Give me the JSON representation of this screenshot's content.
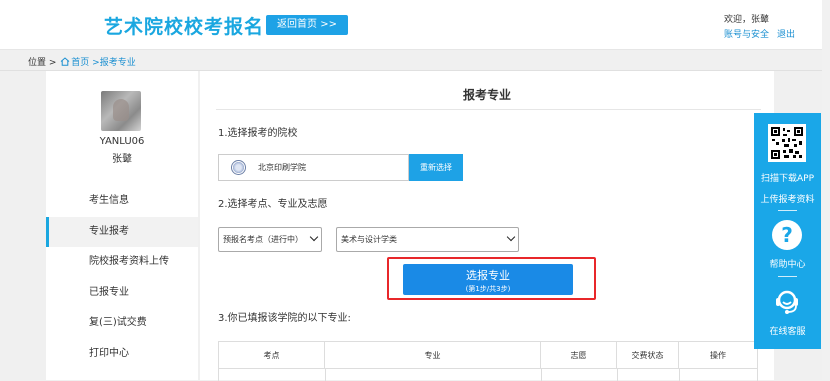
{
  "header": {
    "site_title": "艺术院校校考报名",
    "home_button": "返回首页 >>",
    "welcome": "欢迎，张鼙",
    "account_security": "账号与安全",
    "logout": "退出"
  },
  "breadcrumb": {
    "position": "位置 >",
    "home": "首页",
    "current": ">报考专业"
  },
  "sidebar": {
    "username": "YANLU06",
    "realname": "张鼙",
    "items": [
      {
        "label": "考生信息"
      },
      {
        "label": "专业报考"
      },
      {
        "label": "院校报考资料上传"
      },
      {
        "label": "已报专业"
      },
      {
        "label": "复(三)试交费"
      },
      {
        "label": "打印中心"
      }
    ]
  },
  "main": {
    "title": "报考专业",
    "step1": "1.选择报考的院校",
    "school_name": "北京印刷学院",
    "reselect": "重新选择",
    "step2": "2.选择考点、专业及志愿",
    "exam_site_select": "预报名考点（进行中）",
    "major_select": "美术与设计学类",
    "submit_line1": "选报专业",
    "submit_line2": "(第1步/共3步)",
    "step3": "3.你已填报该学院的以下专业:",
    "table_headers": [
      "考点",
      "专业",
      "志愿",
      "交费状态",
      "操作"
    ]
  },
  "floatbar": {
    "download_app": "扫描下载APP",
    "upload": "上传报考资料",
    "help": "帮助中心",
    "service": "在线客服",
    "help_icon": "?"
  },
  "colors": {
    "brand": "#1aa7e0",
    "button": "#1ea2e6",
    "highlight": "#e8272a"
  }
}
